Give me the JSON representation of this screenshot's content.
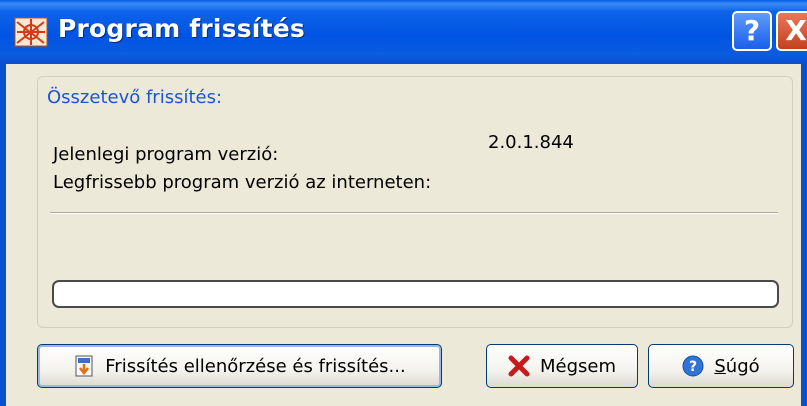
{
  "window": {
    "title": "Program frissítés",
    "help_glyph": "?",
    "close_glyph": "X"
  },
  "group": {
    "legend": "Összetevő frissítés:"
  },
  "info": {
    "current_label": "Jelenlegi program verzió:",
    "current_value": "2.0.1.844",
    "latest_label": "Legfrissebb program verzió az interneten:",
    "latest_value": ""
  },
  "progress": {
    "value": 0
  },
  "buttons": {
    "check_update": "Frissítés ellenőrzése és frissítés...",
    "cancel": "Mégsem",
    "help_first": "S",
    "help_rest": "úgó"
  },
  "icons": {
    "app": "app-logo-icon",
    "check_update": "download-arrow-icon",
    "cancel": "red-x-icon",
    "help": "question-circle-icon"
  },
  "colors": {
    "titlebar": "#0054e3",
    "legend": "#1a55d8",
    "dialog_bg": "#ece9d8",
    "close_btn": "#c4401f"
  }
}
